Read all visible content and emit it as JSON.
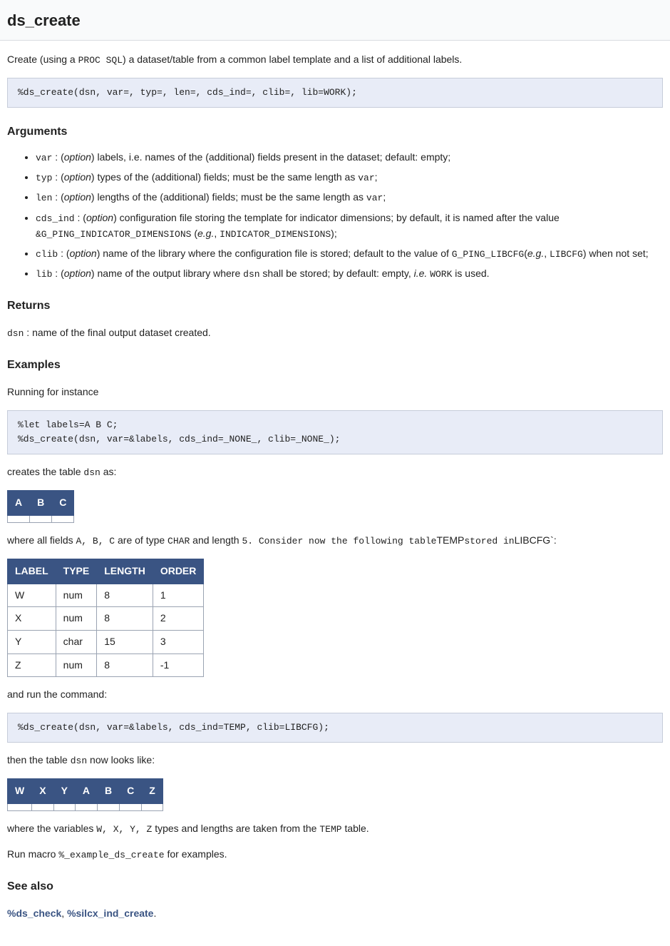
{
  "title": "ds_create",
  "intro": {
    "prefix": "Create (using a ",
    "code": "PROC SQL",
    "suffix": ") a dataset/table from a common label template and a list of additional labels."
  },
  "signature": "%ds_create(dsn, var=, typ=, len=, cds_ind=, clib=, lib=WORK);",
  "headings": {
    "arguments": "Arguments",
    "returns": "Returns",
    "examples": "Examples",
    "see_also": "See also"
  },
  "option_word": "option",
  "arguments": [
    {
      "name": "var",
      "text_parts": [
        {
          "t": "text",
          "v": " : ("
        },
        {
          "t": "opt"
        },
        {
          "t": "text",
          "v": ") labels, i.e. names of the (additional) fields present in the dataset; default: empty;"
        }
      ]
    },
    {
      "name": "typ",
      "text_parts": [
        {
          "t": "text",
          "v": " : ("
        },
        {
          "t": "opt"
        },
        {
          "t": "text",
          "v": ") types of the (additional) fields; must be the same length as "
        },
        {
          "t": "code",
          "v": "var"
        },
        {
          "t": "text",
          "v": ";"
        }
      ]
    },
    {
      "name": "len",
      "text_parts": [
        {
          "t": "text",
          "v": " : ("
        },
        {
          "t": "opt"
        },
        {
          "t": "text",
          "v": ") lengths of the (additional) fields; must be the same length as "
        },
        {
          "t": "code",
          "v": "var"
        },
        {
          "t": "text",
          "v": ";"
        }
      ]
    },
    {
      "name": "cds_ind",
      "text_parts": [
        {
          "t": "text",
          "v": " : ("
        },
        {
          "t": "opt"
        },
        {
          "t": "text",
          "v": ") configuration file storing the template for indicator dimensions; by default, it is named after the value "
        },
        {
          "t": "code",
          "v": "&G_PING_INDICATOR_DIMENSIONS"
        },
        {
          "t": "text",
          "v": " ("
        },
        {
          "t": "ital",
          "v": "e.g."
        },
        {
          "t": "text",
          "v": ", "
        },
        {
          "t": "code",
          "v": "INDICATOR_DIMENSIONS"
        },
        {
          "t": "text",
          "v": ");"
        }
      ]
    },
    {
      "name": "clib",
      "text_parts": [
        {
          "t": "text",
          "v": " : ("
        },
        {
          "t": "opt"
        },
        {
          "t": "text",
          "v": ") name of the library where the configuration file is stored; default to the value of "
        },
        {
          "t": "code",
          "v": "G_PING_LIBCFG"
        },
        {
          "t": "text",
          "v": "("
        },
        {
          "t": "ital",
          "v": "e.g."
        },
        {
          "t": "text",
          "v": ", "
        },
        {
          "t": "code",
          "v": "LIBCFG"
        },
        {
          "t": "text",
          "v": ") when not set;"
        }
      ]
    },
    {
      "name": "lib",
      "text_parts": [
        {
          "t": "text",
          "v": " : ("
        },
        {
          "t": "opt"
        },
        {
          "t": "text",
          "v": ") name of the output library where "
        },
        {
          "t": "code",
          "v": "dsn"
        },
        {
          "t": "text",
          "v": " shall be stored; by default: empty, "
        },
        {
          "t": "ital",
          "v": "i.e."
        },
        {
          "t": "text",
          "v": " "
        },
        {
          "t": "code",
          "v": "WORK"
        },
        {
          "t": "text",
          "v": " is used."
        }
      ]
    }
  ],
  "returns": {
    "code": "dsn",
    "text": " : name of the final output dataset created."
  },
  "examples": {
    "intro": "Running for instance",
    "code1": "%let labels=A B C;\n%ds_create(dsn, var=&labels, cds_ind=_NONE_, clib=_NONE_);",
    "creates_prefix": "creates the table ",
    "creates_code": "dsn",
    "creates_suffix": " as:",
    "table1_headers": [
      "A",
      "B",
      "C"
    ],
    "where_parts": [
      {
        "t": "text",
        "v": "where all fields "
      },
      {
        "t": "code",
        "v": "A, B, C"
      },
      {
        "t": "text",
        "v": " are of type "
      },
      {
        "t": "code",
        "v": "CHAR"
      },
      {
        "t": "text",
        "v": " and length "
      },
      {
        "t": "code",
        "v": "5. Consider now the following table"
      },
      {
        "t": "text",
        "v": "TEMP"
      },
      {
        "t": "code",
        "v": "stored in"
      },
      {
        "t": "text",
        "v": "LIBCFG`:"
      }
    ],
    "table2_headers": [
      "LABEL",
      "TYPE",
      "LENGTH",
      "ORDER"
    ],
    "table2_rows": [
      [
        "W",
        "num",
        "8",
        "1"
      ],
      [
        "X",
        "num",
        "8",
        "2"
      ],
      [
        "Y",
        "char",
        "15",
        "3"
      ],
      [
        "Z",
        "num",
        "8",
        "-1"
      ]
    ],
    "and_run": "and run the command:",
    "code2": "%ds_create(dsn, var=&labels, cds_ind=TEMP, clib=LIBCFG);",
    "then_prefix": "then the table ",
    "then_code": "dsn",
    "then_suffix": " now looks like:",
    "table3_headers": [
      "W",
      "X",
      "Y",
      "A",
      "B",
      "C",
      "Z"
    ],
    "where2_parts": [
      {
        "t": "text",
        "v": "where the variables "
      },
      {
        "t": "code",
        "v": "W, X, Y, Z"
      },
      {
        "t": "text",
        "v": " types and lengths are taken from the "
      },
      {
        "t": "code",
        "v": "TEMP"
      },
      {
        "t": "text",
        "v": " table."
      }
    ],
    "run_macro_prefix": "Run macro ",
    "run_macro_code": "%_example_ds_create",
    "run_macro_suffix": " for examples."
  },
  "see_also": {
    "links": [
      "%ds_check",
      "%silcx_ind_create"
    ],
    "separator": ", ",
    "suffix": "."
  }
}
